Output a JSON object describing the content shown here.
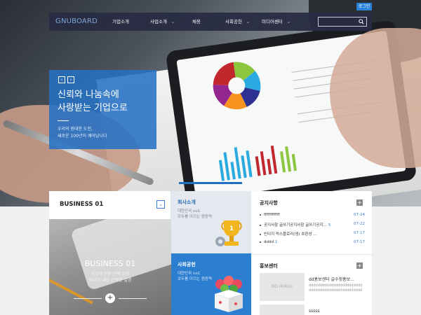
{
  "header": {
    "login_label": "로그인",
    "logo": "GNUBOARD",
    "nav": [
      {
        "label": "기업소개",
        "has_sub": false
      },
      {
        "label": "사업소개",
        "has_sub": true
      },
      {
        "label": "채용",
        "has_sub": false
      },
      {
        "label": "사회공헌",
        "has_sub": true
      },
      {
        "label": "미디어센터",
        "has_sub": true
      }
    ],
    "search_value": ""
  },
  "slide": {
    "prev": "‹",
    "next": "›",
    "title": "신뢰와 나눔속에\n사랑받는 기업으로",
    "desc": "우리의 원대한 도전,\n새로운 100년이 깨어납니다"
  },
  "business": {
    "title": "BUSINESS 01",
    "toggle": "⌄",
    "image_title": "BUSINESS 01",
    "image_lines": [
      "사업에 관한 간략 설명",
      "회사에 대한 간략한 설명"
    ],
    "plus": "+"
  },
  "cards": {
    "company": {
      "title": "회사소개",
      "sub": "대한민국 no1\n모두를 이끄는 원동력"
    },
    "social": {
      "title": "사회공헌",
      "sub": "대한민국 no1\n모두를 이끄는 원동력"
    }
  },
  "notice": {
    "title": "공지사항",
    "more": "+",
    "items": [
      {
        "text": "ffffffffffff",
        "count": "",
        "date": "07-24"
      },
      {
        "text": "공지사항 글쓰기공지사항 글쓰기공지...",
        "count": "5",
        "date": "07-22"
      },
      {
        "text": "빈티지 럭스플로러(생) 호환성 ...",
        "count": "",
        "date": "07-17"
      },
      {
        "text": "dddd",
        "count": "1",
        "date": "07-17"
      }
    ]
  },
  "promo": {
    "title": "홍보센터",
    "more": "+",
    "items": [
      {
        "no_image": "NO IMAGE",
        "title": "dd홍보센터 글수정홍보...",
        "desc": "dddddddddddddddddddddddddddddddddddddddddddddddddd"
      },
      {
        "no_image": "",
        "title": "sssss",
        "desc": ""
      }
    ]
  },
  "colors": {
    "navbar": "#282c42",
    "accent_blue": "#2671c4",
    "login": "#2b82d9"
  }
}
